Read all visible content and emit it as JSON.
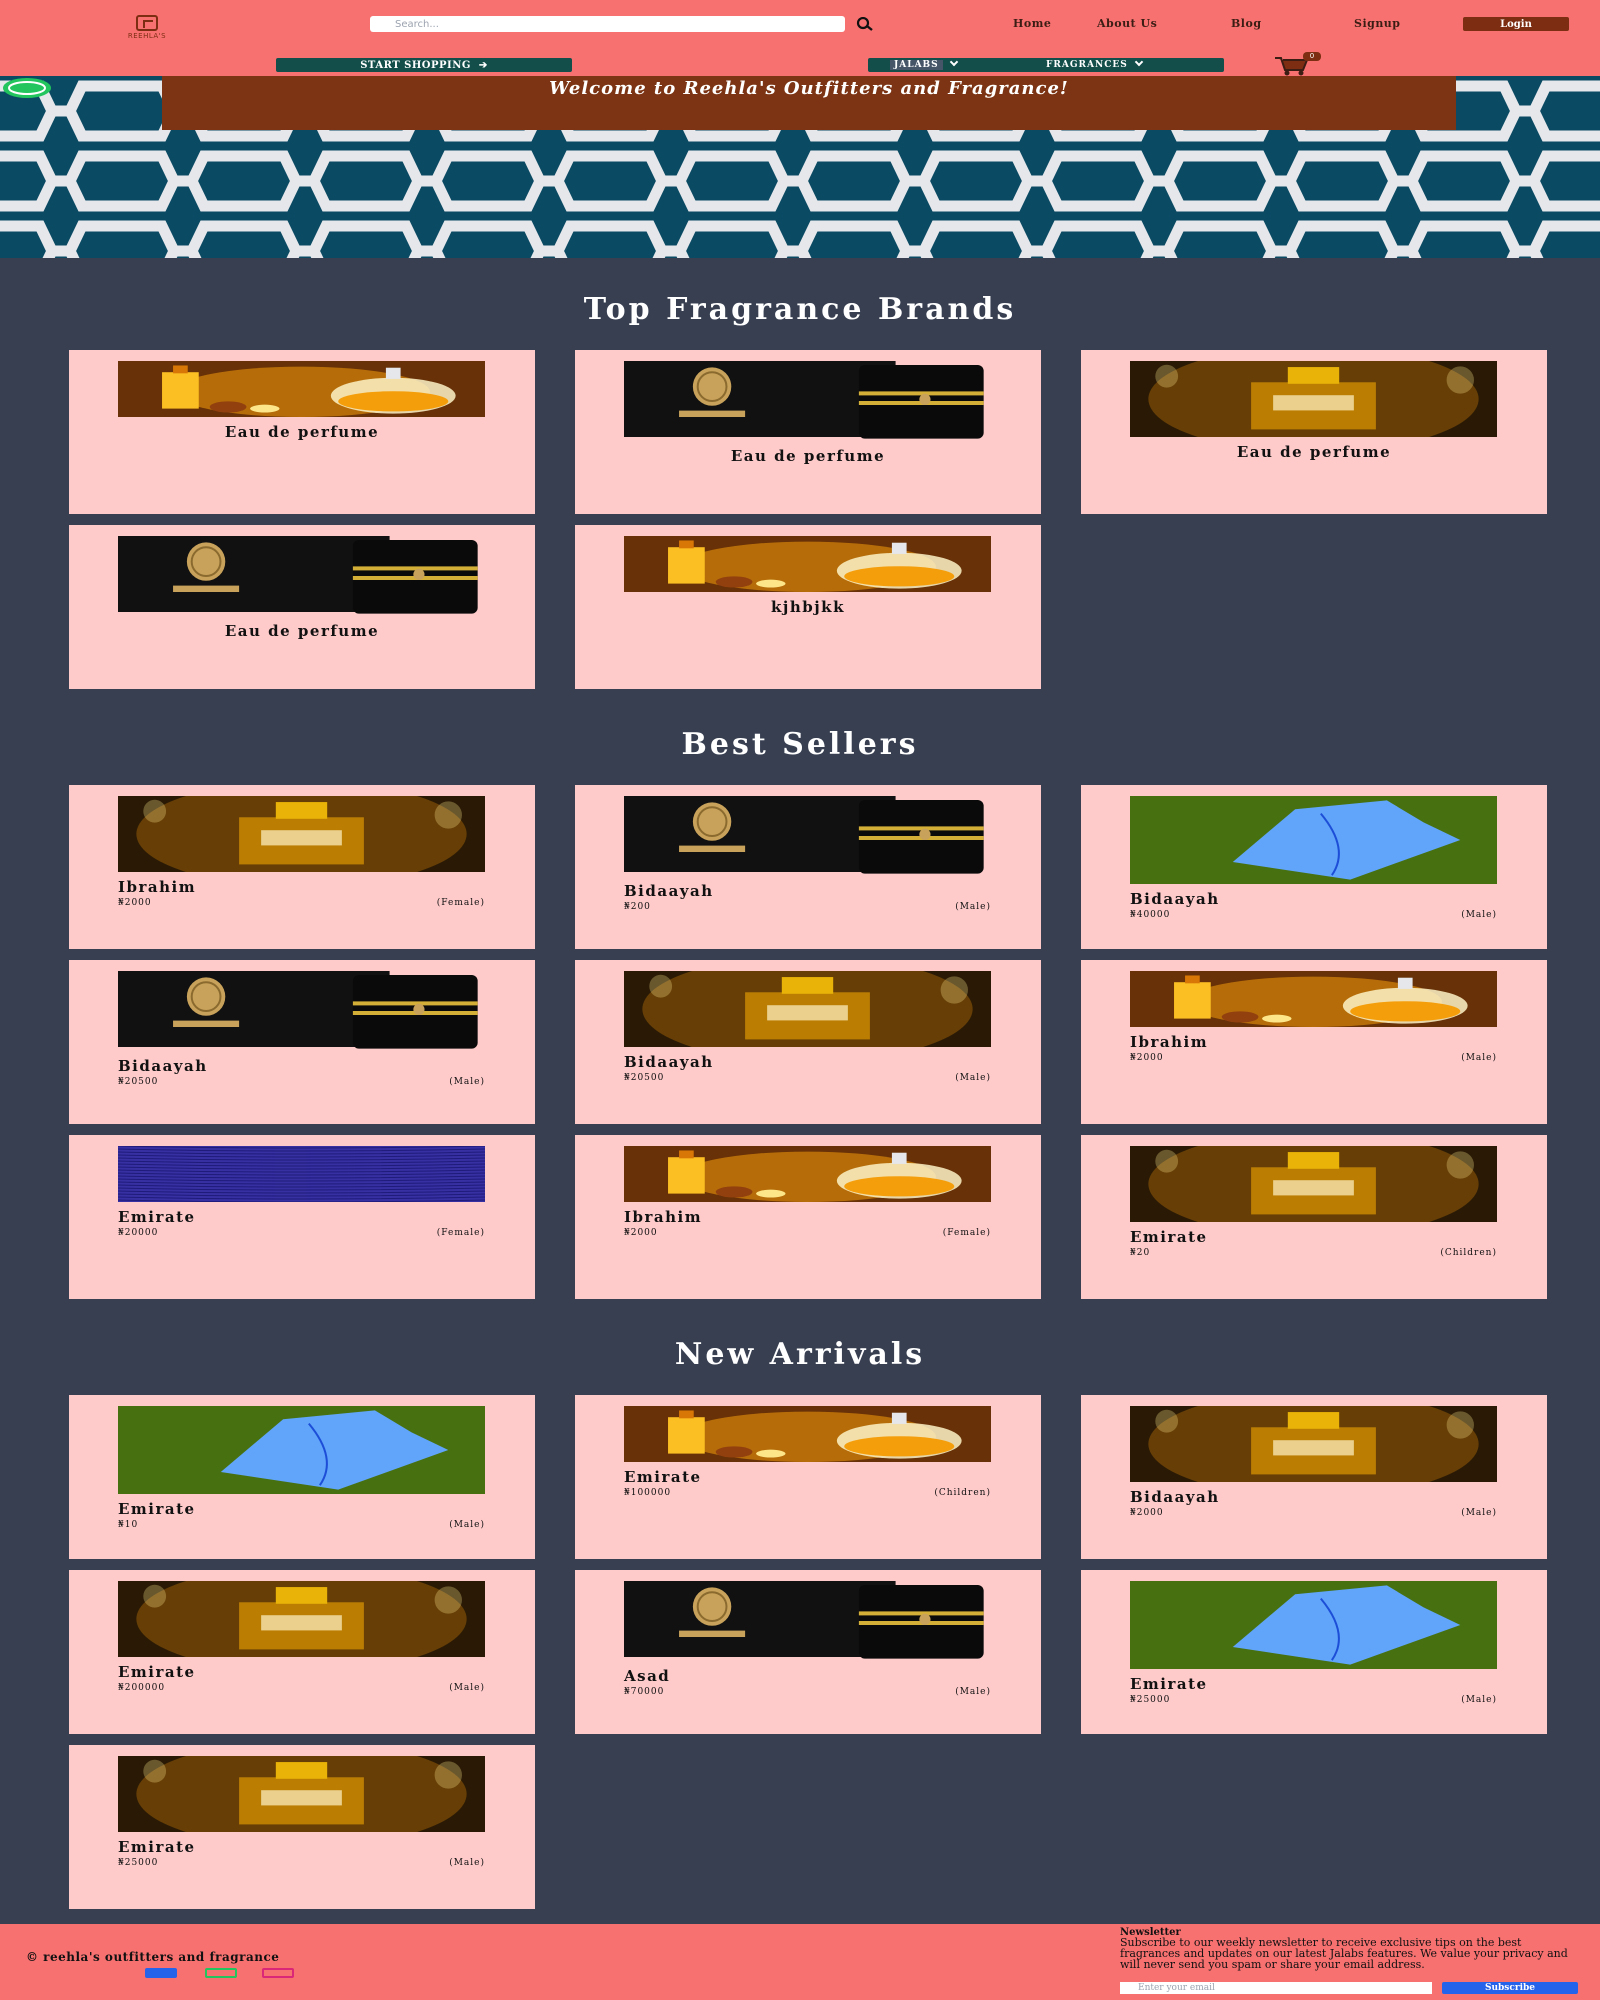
{
  "header": {
    "logo_text": "REEHLA'S",
    "search_placeholder": "Search...",
    "nav": [
      "Home",
      "About Us",
      "Blog",
      "Signup"
    ],
    "login_label": "Login",
    "shop_label": "START SHOPPING",
    "dropdowns": [
      "JALABS",
      "FRAGRANCES"
    ],
    "cart_count": "0"
  },
  "hero": {
    "title": "Welcome to Reehla's Outfitters and Fragrance!"
  },
  "sections": {
    "brands_title": "Top Fragrance Brands",
    "best_title": "Best Sellers",
    "new_title": "New Arrivals"
  },
  "brands": [
    {
      "name": "Eau de perfume",
      "image": "golden-bottles"
    },
    {
      "name": "Eau de perfume",
      "image": "asad-box"
    },
    {
      "name": "Eau de perfume",
      "image": "brand-bottle"
    },
    {
      "name": "Eau de perfume",
      "image": "asad-box"
    },
    {
      "name": "kjhbjkk",
      "image": "golden-bottles"
    }
  ],
  "best_sellers": [
    {
      "name": "Ibrahim",
      "price": "₦2000",
      "gender": "(Female)",
      "image": "brand-bottle"
    },
    {
      "name": "Bidaayah",
      "price": "₦200",
      "gender": "(Male)",
      "image": "asad-box"
    },
    {
      "name": "Bidaayah",
      "price": "₦40000",
      "gender": "(Male)",
      "image": "blue-jalab"
    },
    {
      "name": "Bidaayah",
      "price": "₦20500",
      "gender": "(Male)",
      "image": "asad-box"
    },
    {
      "name": "Bidaayah",
      "price": "₦20500",
      "gender": "(Male)",
      "image": "brand-bottle"
    },
    {
      "name": "Ibrahim",
      "price": "₦2000",
      "gender": "(Male)",
      "image": "golden-bottles"
    },
    {
      "name": "Emirate",
      "price": "₦20000",
      "gender": "(Female)",
      "image": "blue-fabric"
    },
    {
      "name": "Ibrahim",
      "price": "₦2000",
      "gender": "(Female)",
      "image": "golden-bottles"
    },
    {
      "name": "Emirate",
      "price": "₦20",
      "gender": "(Children)",
      "image": "brand-bottle"
    }
  ],
  "new_arrivals": [
    {
      "name": "Emirate",
      "price": "₦10",
      "gender": "(Male)",
      "image": "blue-jalab"
    },
    {
      "name": "Emirate",
      "price": "₦100000",
      "gender": "(Children)",
      "image": "golden-bottles"
    },
    {
      "name": "Bidaayah",
      "price": "₦2000",
      "gender": "(Male)",
      "image": "brand-bottle"
    },
    {
      "name": "Emirate",
      "price": "₦200000",
      "gender": "(Male)",
      "image": "brand-bottle"
    },
    {
      "name": "Asad",
      "price": "₦70000",
      "gender": "(Male)",
      "image": "asad-box"
    },
    {
      "name": "Emirate",
      "price": "₦25000",
      "gender": "(Male)",
      "image": "blue-jalab"
    },
    {
      "name": "Emirate",
      "price": "₦25000",
      "gender": "(Male)",
      "image": "brand-bottle"
    }
  ],
  "footer": {
    "copyright": "© reehla's outfitters and fragrance",
    "newsletter_title": "Newsletter",
    "newsletter_text": "Subscribe to our weekly newsletter to receive exclusive tips on the best fragrances and updates on our latest Jalabs features. We value your privacy and will never send you spam or share your email address.",
    "email_placeholder": "Enter your email",
    "subscribe_label": "Subscribe",
    "social_icons": [
      "facebook-icon",
      "whatsapp-icon",
      "instagram-icon"
    ]
  },
  "colors": {
    "header": "#f87171",
    "page_bg": "#373f51",
    "card_bg": "#fecaca",
    "accent_brown": "#7c2d12",
    "accent_teal": "#134e4a",
    "subscribe": "#2563eb"
  }
}
